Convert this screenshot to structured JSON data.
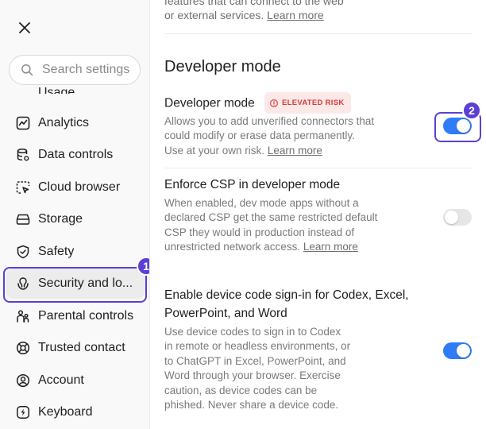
{
  "sidebar": {
    "search_placeholder": "Search settings",
    "partial_item": {
      "label": "Usage",
      "icon": "usage-icon"
    },
    "items": [
      {
        "label": "Analytics",
        "icon": "analytics-icon"
      },
      {
        "label": "Data controls",
        "icon": "data-controls-icon"
      },
      {
        "label": "Cloud browser",
        "icon": "cloud-browser-icon"
      },
      {
        "label": "Storage",
        "icon": "storage-icon"
      },
      {
        "label": "Safety",
        "icon": "shield-icon"
      },
      {
        "label": "Security and lo...",
        "icon": "security-icon",
        "selected": true
      },
      {
        "label": "Parental controls",
        "icon": "parental-controls-icon"
      },
      {
        "label": "Trusted contact",
        "icon": "lifebuoy-icon"
      },
      {
        "label": "Account",
        "icon": "account-icon"
      },
      {
        "label": "Keyboard",
        "icon": "keyboard-icon"
      }
    ]
  },
  "annotations": {
    "badge1": "1",
    "badge2": "2"
  },
  "content": {
    "top_text_line1": "features that can connect to the web",
    "top_text_line2": "or external services.",
    "top_link": "Learn more",
    "section_title": "Developer mode",
    "developer_mode": {
      "title": "Developer mode",
      "risk_label": "ELEVATED RISK",
      "desc_line1": "Allows you to add unverified connectors that",
      "desc_line2": "could modify or erase data permanently.",
      "desc_line3": "Use at your own risk.",
      "link": "Learn more",
      "enabled": true
    },
    "enforce_csp": {
      "title": "Enforce CSP in developer mode",
      "desc_line1": "When enabled, dev mode apps without a",
      "desc_line2": "declared CSP get the same restricted default",
      "desc_line3": "CSP they would in production instead of",
      "desc_line4": "unrestricted network access.",
      "link": "Learn more",
      "enabled": false
    },
    "device_code": {
      "title_line1": "Enable device code sign-in for Codex, Excel,",
      "title_line2": "PowerPoint, and Word",
      "desc_line1": "Use device codes to sign in to Codex",
      "desc_line2": "in remote or headless environments, or",
      "desc_line3": "to ChatGPT in Excel, PowerPoint, and",
      "desc_line4": "Word through your browser. Exercise",
      "desc_line5": "caution, as device codes can be",
      "desc_line6": "phished. Never share a device code.",
      "enabled": true
    }
  },
  "colors": {
    "accent": "#2f7cf6",
    "annotation": "#5b3fd6",
    "risk_text": "#d9383a",
    "risk_bg": "#fde8e8"
  }
}
